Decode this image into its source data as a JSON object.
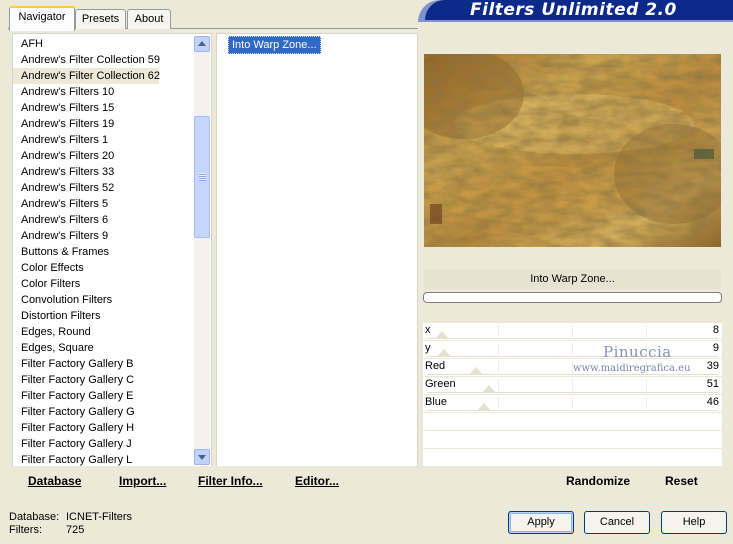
{
  "tabs": [
    {
      "label": "Navigator",
      "active": true
    },
    {
      "label": "Presets",
      "active": false
    },
    {
      "label": "About",
      "active": false
    }
  ],
  "banner": {
    "title": "Filters Unlimited 2.0"
  },
  "categories": {
    "items": [
      "AFH",
      "Andrew's Filter Collection 59",
      "Andrew's Filter Collection 62",
      "Andrew's Filters 10",
      "Andrew's Filters 15",
      "Andrew's Filters 19",
      "Andrew's Filters 1",
      "Andrew's Filters 20",
      "Andrew's Filters 33",
      "Andrew's Filters 52",
      "Andrew's Filters 5",
      "Andrew's Filters 6",
      "Andrew's Filters 9",
      "Buttons & Frames",
      "Color Effects",
      "Color Filters",
      "Convolution Filters",
      "Distortion Filters",
      "Edges, Round",
      "Edges, Square",
      "Filter Factory Gallery B",
      "Filter Factory Gallery C",
      "Filter Factory Gallery E",
      "Filter Factory Gallery G",
      "Filter Factory Gallery H",
      "Filter Factory Gallery J",
      "Filter Factory Gallery L"
    ],
    "selected": "Andrew's Filter Collection 62"
  },
  "filters": {
    "selected": "Into Warp Zone..."
  },
  "left_buttons": {
    "database": "Database",
    "import": "Import...",
    "filter_info": "Filter Info...",
    "editor": "Editor..."
  },
  "preview": {
    "label": "Into Warp Zone..."
  },
  "params": [
    {
      "label": "x",
      "value": "8",
      "level": 0.03
    },
    {
      "label": "y",
      "value": "9",
      "level": 0.035
    },
    {
      "label": "Red",
      "value": "39",
      "level": 0.153
    },
    {
      "label": "Green",
      "value": "51",
      "level": 0.2
    },
    {
      "label": "Blue",
      "value": "46",
      "level": 0.18
    }
  ],
  "right_buttons": {
    "randomize": "Randomize",
    "reset": "Reset"
  },
  "watermark": {
    "name": "Pinuccia",
    "site": "www.maidiregrafica.eu"
  },
  "status": {
    "database_label": "Database:",
    "database_value": "ICNET-Filters",
    "filters_label": "Filters:",
    "filters_value": "725"
  },
  "dialog_buttons": {
    "apply": "Apply",
    "cancel": "Cancel",
    "help": "Help"
  },
  "colors": {
    "banner": "#0d2a8a",
    "selection": "#316ac5",
    "face": "#ece9d8"
  }
}
